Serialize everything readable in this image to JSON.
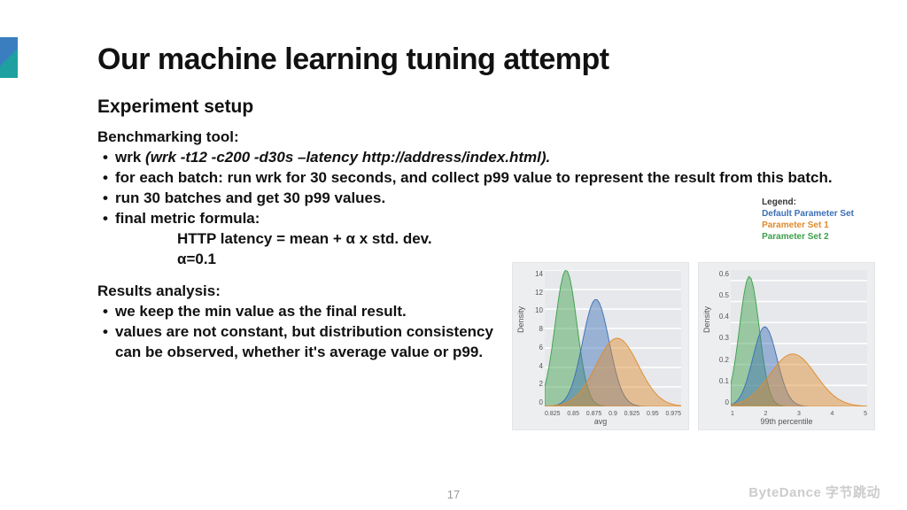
{
  "title": "Our machine learning tuning attempt",
  "subtitle": "Experiment setup",
  "bench_label": "Benchmarking tool:",
  "bullets_bench": [
    {
      "prefix": "wrk ",
      "cmd": "(wrk -t12 -c200 -d30s –latency http://address/index.html)."
    },
    {
      "text": "for each batch: run wrk for 30 seconds, and collect p99 value to represent the result from this batch."
    },
    {
      "text": "run 30 batches and get 30 p99 values."
    },
    {
      "text": "final metric formula:"
    }
  ],
  "formula1": "HTTP latency = mean + α x std. dev.",
  "formula2": "α=0.1",
  "results_label": "Results analysis:",
  "bullets_results": [
    {
      "text": "we keep the min value as the final result."
    },
    {
      "text": "values are not constant, but distribution consistency can be observed, whether it's average value or p99."
    }
  ],
  "legend": {
    "title": "Legend:",
    "a": "Default Parameter Set",
    "b": "Parameter Set 1",
    "c": "Parameter Set 2"
  },
  "page": "17",
  "watermark": "ByteDance 字节跳动",
  "chart_data": [
    {
      "type": "area",
      "title": "",
      "xlabel": "avg",
      "ylabel": "Density",
      "xlim": [
        0.82,
        0.98
      ],
      "ylim": [
        0,
        14
      ],
      "xticks": [
        0.825,
        0.85,
        0.875,
        0.9,
        0.925,
        0.95,
        0.975
      ],
      "yticks": [
        0,
        2,
        4,
        6,
        8,
        10,
        12,
        14
      ],
      "series": [
        {
          "name": "Parameter Set 2",
          "color": "#3ca04a",
          "peak_x": 0.845,
          "peak_y": 14,
          "spread": 0.018
        },
        {
          "name": "Default Parameter Set",
          "color": "#3b6fb5",
          "peak_x": 0.88,
          "peak_y": 11,
          "spread": 0.022
        },
        {
          "name": "Parameter Set 1",
          "color": "#e08b2c",
          "peak_x": 0.905,
          "peak_y": 7,
          "spread": 0.035
        }
      ]
    },
    {
      "type": "area",
      "title": "",
      "xlabel": "99th percentile",
      "ylabel": "Density",
      "xlim": [
        0.8,
        5.2
      ],
      "ylim": [
        0,
        0.65
      ],
      "xticks": [
        1,
        2,
        3,
        4,
        5
      ],
      "yticks": [
        0.0,
        0.1,
        0.2,
        0.3,
        0.4,
        0.5,
        0.6
      ],
      "series": [
        {
          "name": "Parameter Set 2",
          "color": "#3ca04a",
          "peak_x": 1.4,
          "peak_y": 0.62,
          "spread": 0.45
        },
        {
          "name": "Default Parameter Set",
          "color": "#3b6fb5",
          "peak_x": 1.9,
          "peak_y": 0.38,
          "spread": 0.55
        },
        {
          "name": "Parameter Set 1",
          "color": "#e08b2c",
          "peak_x": 2.8,
          "peak_y": 0.25,
          "spread": 1.05
        }
      ]
    }
  ]
}
